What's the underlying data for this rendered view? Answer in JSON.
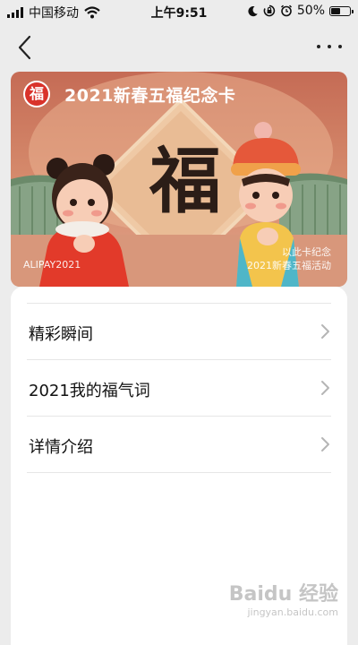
{
  "status_bar": {
    "carrier": "中国移动",
    "time": "上午9:51",
    "battery": "50%",
    "battery_level": 0.5,
    "icons": [
      "signal-icon",
      "wifi-icon",
      "moon-icon",
      "orientation-lock-icon",
      "alarm-icon",
      "battery-icon"
    ]
  },
  "nav": {
    "back_icon": "chevron-left-icon",
    "more_icon": "more-icon"
  },
  "card": {
    "title": "2021新春五福纪念卡",
    "logo_char": "福",
    "center_char": "福",
    "brand": "ALIPAY2021",
    "note_line1": "以此卡纪念",
    "note_line2": "2021新春五福活动",
    "colors": {
      "bg_top": "#c56b55",
      "bg_bottom": "#e1a38a",
      "logo_red": "#d9332b"
    }
  },
  "menu": {
    "items": [
      {
        "label": "精彩瞬间"
      },
      {
        "label": "2021我的福气词"
      },
      {
        "label": "详情介绍"
      }
    ]
  },
  "watermark": {
    "line1": "Baidu 经验",
    "line2": "jingyan.baidu.com"
  }
}
